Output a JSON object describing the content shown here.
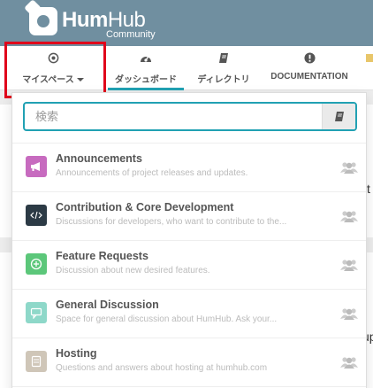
{
  "header": {
    "brand_hum": "Hum",
    "brand_hub": "Hub",
    "subtitle": "Community"
  },
  "nav": {
    "my_spaces": "マイスペース",
    "dashboard": "ダッシュボード",
    "directory": "ディレクトリ",
    "documentation": "DOCUMENTATION"
  },
  "search": {
    "placeholder": "検索",
    "value": ""
  },
  "spaces": [
    {
      "name": "Announcements",
      "description": "Announcements of project releases and updates.",
      "color": "#c76bbf",
      "icon": "megaphone-icon"
    },
    {
      "name": "Contribution & Core Development",
      "description": "Discussions for developers, who want to contribute to the...",
      "color": "#2c3a45",
      "icon": "code-icon"
    },
    {
      "name": "Feature Requests",
      "description": "Discussion about new desired features.",
      "color": "#5cc77a",
      "icon": "plus-circle-icon"
    },
    {
      "name": "General Discussion",
      "description": "Space for general discussion about HumHub. Ask your...",
      "color": "#8ed8c9",
      "icon": "chat-icon"
    },
    {
      "name": "Hosting",
      "description": "Questions and answers about hosting at humhub.com",
      "color": "#cfc6b8",
      "icon": "server-icon"
    }
  ],
  "background_hints": [
    "t",
    "up"
  ],
  "colors": {
    "header_bg": "#708fa0",
    "accent": "#21a1b3",
    "highlight": "#e0001b"
  }
}
